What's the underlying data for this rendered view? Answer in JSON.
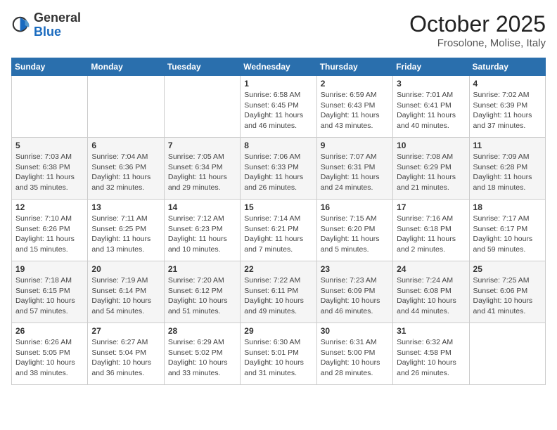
{
  "header": {
    "logo_general": "General",
    "logo_blue": "Blue",
    "month": "October 2025",
    "location": "Frosolone, Molise, Italy"
  },
  "weekdays": [
    "Sunday",
    "Monday",
    "Tuesday",
    "Wednesday",
    "Thursday",
    "Friday",
    "Saturday"
  ],
  "weeks": [
    [
      {
        "day": "",
        "sunrise": "",
        "sunset": "",
        "daylight": ""
      },
      {
        "day": "",
        "sunrise": "",
        "sunset": "",
        "daylight": ""
      },
      {
        "day": "",
        "sunrise": "",
        "sunset": "",
        "daylight": ""
      },
      {
        "day": "1",
        "sunrise": "Sunrise: 6:58 AM",
        "sunset": "Sunset: 6:45 PM",
        "daylight": "Daylight: 11 hours and 46 minutes."
      },
      {
        "day": "2",
        "sunrise": "Sunrise: 6:59 AM",
        "sunset": "Sunset: 6:43 PM",
        "daylight": "Daylight: 11 hours and 43 minutes."
      },
      {
        "day": "3",
        "sunrise": "Sunrise: 7:01 AM",
        "sunset": "Sunset: 6:41 PM",
        "daylight": "Daylight: 11 hours and 40 minutes."
      },
      {
        "day": "4",
        "sunrise": "Sunrise: 7:02 AM",
        "sunset": "Sunset: 6:39 PM",
        "daylight": "Daylight: 11 hours and 37 minutes."
      }
    ],
    [
      {
        "day": "5",
        "sunrise": "Sunrise: 7:03 AM",
        "sunset": "Sunset: 6:38 PM",
        "daylight": "Daylight: 11 hours and 35 minutes."
      },
      {
        "day": "6",
        "sunrise": "Sunrise: 7:04 AM",
        "sunset": "Sunset: 6:36 PM",
        "daylight": "Daylight: 11 hours and 32 minutes."
      },
      {
        "day": "7",
        "sunrise": "Sunrise: 7:05 AM",
        "sunset": "Sunset: 6:34 PM",
        "daylight": "Daylight: 11 hours and 29 minutes."
      },
      {
        "day": "8",
        "sunrise": "Sunrise: 7:06 AM",
        "sunset": "Sunset: 6:33 PM",
        "daylight": "Daylight: 11 hours and 26 minutes."
      },
      {
        "day": "9",
        "sunrise": "Sunrise: 7:07 AM",
        "sunset": "Sunset: 6:31 PM",
        "daylight": "Daylight: 11 hours and 24 minutes."
      },
      {
        "day": "10",
        "sunrise": "Sunrise: 7:08 AM",
        "sunset": "Sunset: 6:29 PM",
        "daylight": "Daylight: 11 hours and 21 minutes."
      },
      {
        "day": "11",
        "sunrise": "Sunrise: 7:09 AM",
        "sunset": "Sunset: 6:28 PM",
        "daylight": "Daylight: 11 hours and 18 minutes."
      }
    ],
    [
      {
        "day": "12",
        "sunrise": "Sunrise: 7:10 AM",
        "sunset": "Sunset: 6:26 PM",
        "daylight": "Daylight: 11 hours and 15 minutes."
      },
      {
        "day": "13",
        "sunrise": "Sunrise: 7:11 AM",
        "sunset": "Sunset: 6:25 PM",
        "daylight": "Daylight: 11 hours and 13 minutes."
      },
      {
        "day": "14",
        "sunrise": "Sunrise: 7:12 AM",
        "sunset": "Sunset: 6:23 PM",
        "daylight": "Daylight: 11 hours and 10 minutes."
      },
      {
        "day": "15",
        "sunrise": "Sunrise: 7:14 AM",
        "sunset": "Sunset: 6:21 PM",
        "daylight": "Daylight: 11 hours and 7 minutes."
      },
      {
        "day": "16",
        "sunrise": "Sunrise: 7:15 AM",
        "sunset": "Sunset: 6:20 PM",
        "daylight": "Daylight: 11 hours and 5 minutes."
      },
      {
        "day": "17",
        "sunrise": "Sunrise: 7:16 AM",
        "sunset": "Sunset: 6:18 PM",
        "daylight": "Daylight: 11 hours and 2 minutes."
      },
      {
        "day": "18",
        "sunrise": "Sunrise: 7:17 AM",
        "sunset": "Sunset: 6:17 PM",
        "daylight": "Daylight: 10 hours and 59 minutes."
      }
    ],
    [
      {
        "day": "19",
        "sunrise": "Sunrise: 7:18 AM",
        "sunset": "Sunset: 6:15 PM",
        "daylight": "Daylight: 10 hours and 57 minutes."
      },
      {
        "day": "20",
        "sunrise": "Sunrise: 7:19 AM",
        "sunset": "Sunset: 6:14 PM",
        "daylight": "Daylight: 10 hours and 54 minutes."
      },
      {
        "day": "21",
        "sunrise": "Sunrise: 7:20 AM",
        "sunset": "Sunset: 6:12 PM",
        "daylight": "Daylight: 10 hours and 51 minutes."
      },
      {
        "day": "22",
        "sunrise": "Sunrise: 7:22 AM",
        "sunset": "Sunset: 6:11 PM",
        "daylight": "Daylight: 10 hours and 49 minutes."
      },
      {
        "day": "23",
        "sunrise": "Sunrise: 7:23 AM",
        "sunset": "Sunset: 6:09 PM",
        "daylight": "Daylight: 10 hours and 46 minutes."
      },
      {
        "day": "24",
        "sunrise": "Sunrise: 7:24 AM",
        "sunset": "Sunset: 6:08 PM",
        "daylight": "Daylight: 10 hours and 44 minutes."
      },
      {
        "day": "25",
        "sunrise": "Sunrise: 7:25 AM",
        "sunset": "Sunset: 6:06 PM",
        "daylight": "Daylight: 10 hours and 41 minutes."
      }
    ],
    [
      {
        "day": "26",
        "sunrise": "Sunrise: 6:26 AM",
        "sunset": "Sunset: 5:05 PM",
        "daylight": "Daylight: 10 hours and 38 minutes."
      },
      {
        "day": "27",
        "sunrise": "Sunrise: 6:27 AM",
        "sunset": "Sunset: 5:04 PM",
        "daylight": "Daylight: 10 hours and 36 minutes."
      },
      {
        "day": "28",
        "sunrise": "Sunrise: 6:29 AM",
        "sunset": "Sunset: 5:02 PM",
        "daylight": "Daylight: 10 hours and 33 minutes."
      },
      {
        "day": "29",
        "sunrise": "Sunrise: 6:30 AM",
        "sunset": "Sunset: 5:01 PM",
        "daylight": "Daylight: 10 hours and 31 minutes."
      },
      {
        "day": "30",
        "sunrise": "Sunrise: 6:31 AM",
        "sunset": "Sunset: 5:00 PM",
        "daylight": "Daylight: 10 hours and 28 minutes."
      },
      {
        "day": "31",
        "sunrise": "Sunrise: 6:32 AM",
        "sunset": "Sunset: 4:58 PM",
        "daylight": "Daylight: 10 hours and 26 minutes."
      },
      {
        "day": "",
        "sunrise": "",
        "sunset": "",
        "daylight": ""
      }
    ]
  ]
}
